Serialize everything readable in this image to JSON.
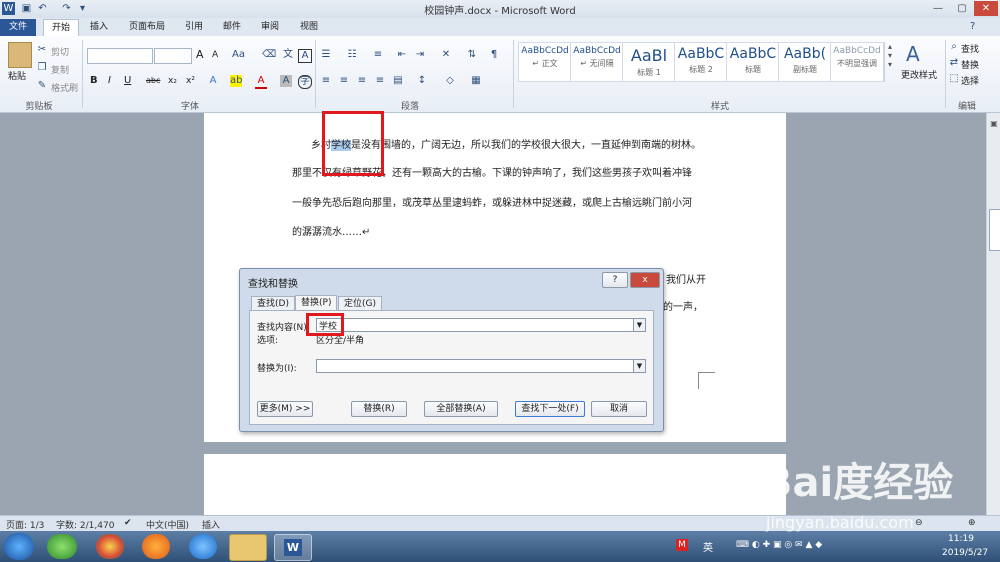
{
  "window": {
    "title": "校园钟声.docx - Microsoft Word"
  },
  "tabs": [
    {
      "label": "文件"
    },
    {
      "label": "开始"
    },
    {
      "label": "插入"
    },
    {
      "label": "页面布局"
    },
    {
      "label": "引用"
    },
    {
      "label": "邮件"
    },
    {
      "label": "审阅"
    },
    {
      "label": "视图"
    }
  ],
  "ribbon": {
    "clipboard": {
      "paste": "粘贴",
      "cut": "剪切",
      "copy": "复制",
      "format_painter": "格式刷",
      "label": "剪贴板"
    },
    "font": {
      "label": "字体",
      "grow": "A",
      "shrink": "A",
      "bold": "B",
      "italic": "I",
      "underline": "U",
      "strike": "abc",
      "sub": "x₂",
      "sup": "x²"
    },
    "paragraph": {
      "label": "段落"
    },
    "styles": {
      "label": "样式",
      "change": "更改样式",
      "items": [
        {
          "sample": "AaBbCcDd",
          "name": "↵ 正文"
        },
        {
          "sample": "AaBbCcDd",
          "name": "↵ 无间隔"
        },
        {
          "sample": "AaBl",
          "name": "标题 1"
        },
        {
          "sample": "AaBbC",
          "name": "标题 2"
        },
        {
          "sample": "AaBbC",
          "name": "标题"
        },
        {
          "sample": "AaBb(",
          "name": "副标题"
        },
        {
          "sample": "AaBbCcDd",
          "name": "不明显强调"
        }
      ]
    },
    "editing": {
      "label": "编辑",
      "find": "查找",
      "replace": "替换",
      "select": "选择"
    }
  },
  "document": {
    "line1_pre": "乡村",
    "line1_hl": "学校",
    "line1_post": "是没有围墙的，广阔无边，所以我们的学校很大很大，一直延伸到南端的树林。",
    "line2": "那里不仅有绿草野花，还有一颗高大的古榆。下课的钟声响了，我们这些男孩子欢叫着冲锋",
    "line3": "一般争先恐后跑向那里，或茂草丛里逮蚂蚱，或躲进林中捉迷藏，或爬上古榆远眺门前小河",
    "line4": "的潺潺流水……↵",
    "hidden1": "我们从开",
    "hidden2": "的一声，"
  },
  "dialog": {
    "title": "查找和替换",
    "help": "?",
    "close": "x",
    "tabs": [
      "查找(D)",
      "替换(P)",
      "定位(G)"
    ],
    "find_label": "查找内容(N):",
    "find_value": "学校",
    "options_label": "选项:",
    "options_value": "区分全/半角",
    "replace_label": "替换为(I):",
    "replace_value": "",
    "buttons": {
      "more": "更多(M) >>",
      "replace": "替换(R)",
      "replace_all": "全部替换(A)",
      "find_next": "查找下一处(F)",
      "cancel": "取消"
    }
  },
  "statusbar": {
    "page": "页面: 1/3",
    "words": "字数: 2/1,470",
    "lang": "中文(中国)",
    "insert": "插入"
  },
  "taskbar": {
    "clock_time": "11:19",
    "clock_date": "2019/5/27",
    "ime": "英"
  },
  "watermark": {
    "brand": "Bai度经验",
    "url": "jingyan.baidu.com"
  },
  "colors": {
    "accent": "#2b5797",
    "highlight": "#a9cbee",
    "annotation": "#e0191f"
  }
}
